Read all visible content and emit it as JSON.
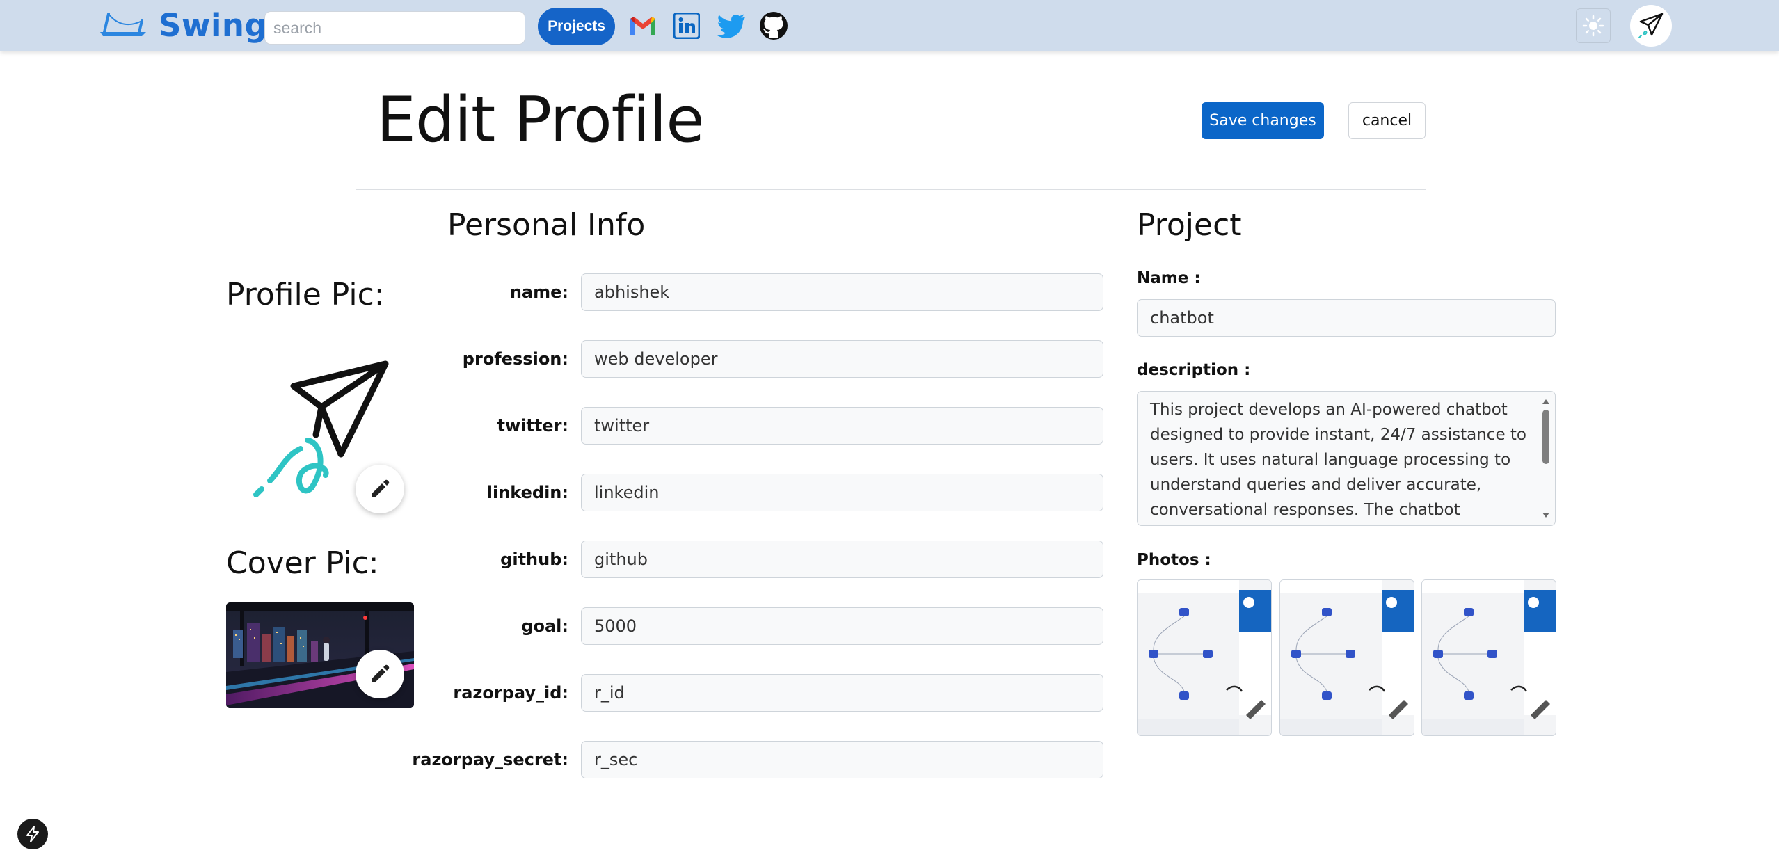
{
  "navbar": {
    "brand": "Swing",
    "search_placeholder": "search",
    "projects_label": "Projects",
    "social_icons": [
      "gmail-icon",
      "linkedin-icon",
      "twitter-icon",
      "github-icon"
    ],
    "accent_color": "#1f6fd1"
  },
  "header": {
    "title": "Edit Profile",
    "save_label": "Save changes",
    "cancel_label": "cancel"
  },
  "pictures": {
    "profile_heading": "Profile Pic:",
    "cover_heading": "Cover Pic:"
  },
  "personal": {
    "heading": "Personal Info",
    "fields": [
      {
        "label": "name:",
        "value": "abhishek"
      },
      {
        "label": "profession:",
        "value": "web developer"
      },
      {
        "label": "twitter:",
        "value": "twitter"
      },
      {
        "label": "linkedin:",
        "value": "linkedin"
      },
      {
        "label": "github:",
        "value": "github"
      },
      {
        "label": "goal:",
        "value": "5000"
      },
      {
        "label": "razorpay_id:",
        "value": "r_id"
      },
      {
        "label": "razorpay_secret:",
        "value": "r_sec"
      }
    ]
  },
  "project": {
    "heading": "Project",
    "name_label": "Name :",
    "name_value": "chatbot",
    "description_label": "description :",
    "description_value": "This project develops an AI-powered chatbot designed to provide instant, 24/7 assistance to users. It uses natural language processing to understand queries and deliver accurate, conversational responses. The chatbot enhances",
    "photos_label": "Photos :"
  }
}
